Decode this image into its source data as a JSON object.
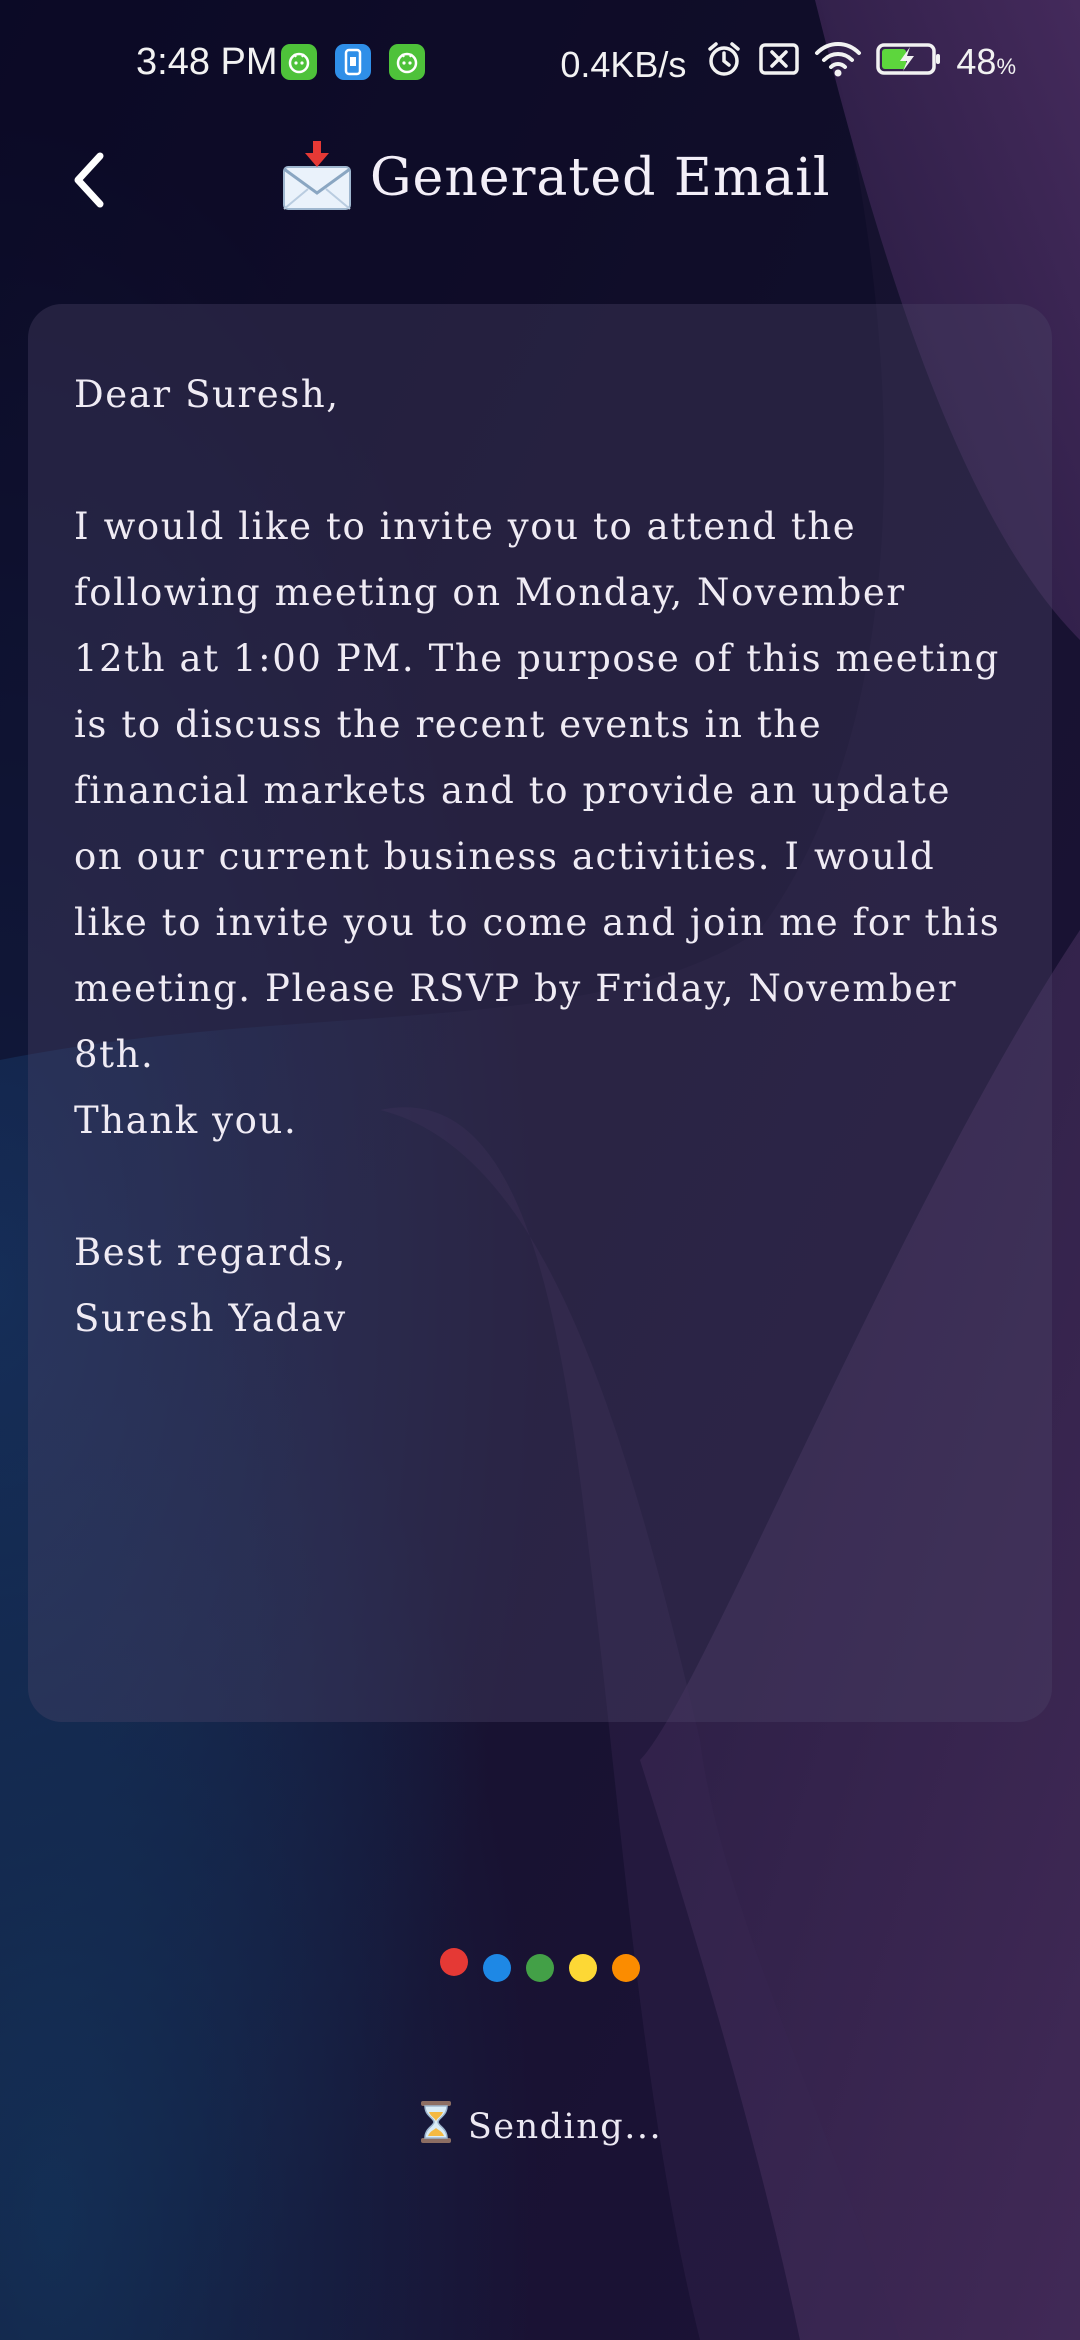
{
  "status_bar": {
    "time": "3:48 PM",
    "net_speed": "0.4KB/s",
    "battery_percent": "48",
    "battery_unit": "%",
    "notification_icons": [
      "android-robot-icon",
      "sim-app-icon",
      "android-robot-icon"
    ],
    "system_icons": [
      "alarm-icon",
      "no-sim-icon",
      "wifi-icon",
      "battery-charging-icon"
    ]
  },
  "header": {
    "title": "Generated Email",
    "title_icon": "envelope-download-icon"
  },
  "email": {
    "body": "Dear Suresh,\n\nI would like to invite you to attend the following meeting on Monday, November 12th at 1:00 PM. The purpose of this meeting is to discuss the recent events in the financial markets and to provide an update on our current business activities. I would like to invite you to come and join me for this meeting. Please RSVP by Friday, November 8th.\nThank you.\n\nBest regards,\nSuresh Yadav"
  },
  "loader": {
    "dot_colors": [
      "#e53935",
      "#1e88e5",
      "#43a047",
      "#fdd835",
      "#fb8c00"
    ],
    "status_icon": "hourglass-icon",
    "status_text": "Sending..."
  },
  "colors": {
    "background": "#0f0d2a",
    "accent_wave": "#5a3a6e",
    "text": "#ece8f2"
  }
}
